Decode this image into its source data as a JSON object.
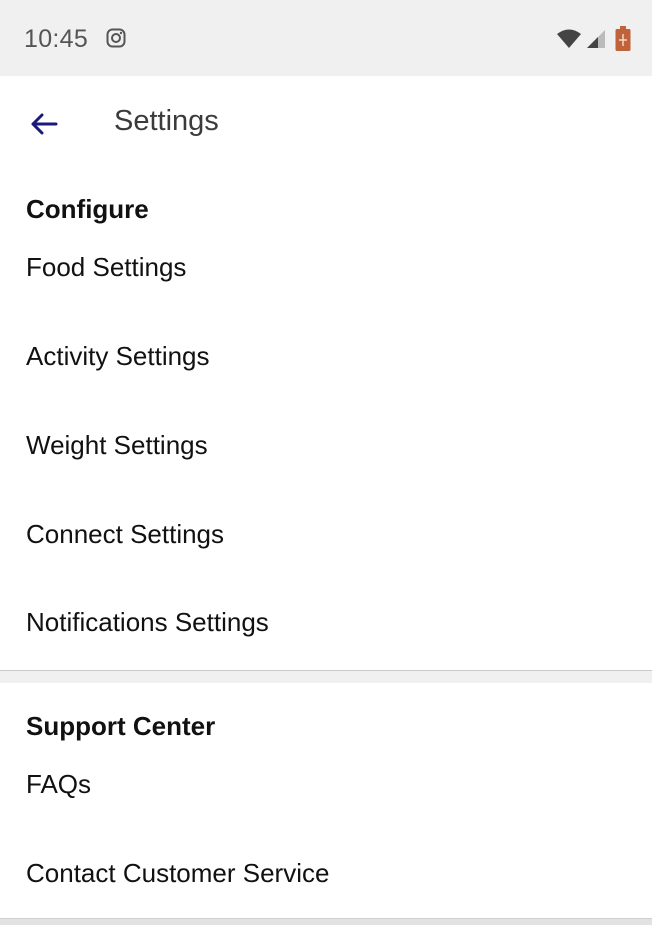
{
  "status_bar": {
    "time": "10:45",
    "notification_icon": "instagram-icon",
    "icons": [
      "wifi-icon",
      "signal-icon",
      "battery-icon"
    ],
    "battery_color": "#c0623a"
  },
  "app_bar": {
    "back_icon": "arrow-left-icon",
    "title": "Settings",
    "accent_color": "#1a1a7a"
  },
  "sections": [
    {
      "heading": "Configure",
      "items": [
        {
          "label": "Food Settings"
        },
        {
          "label": "Activity Settings"
        },
        {
          "label": "Weight Settings"
        },
        {
          "label": "Connect Settings"
        },
        {
          "label": "Notifications Settings"
        }
      ]
    },
    {
      "heading": "Support Center",
      "items": [
        {
          "label": "FAQs"
        },
        {
          "label": "Contact Customer Service"
        }
      ]
    }
  ]
}
